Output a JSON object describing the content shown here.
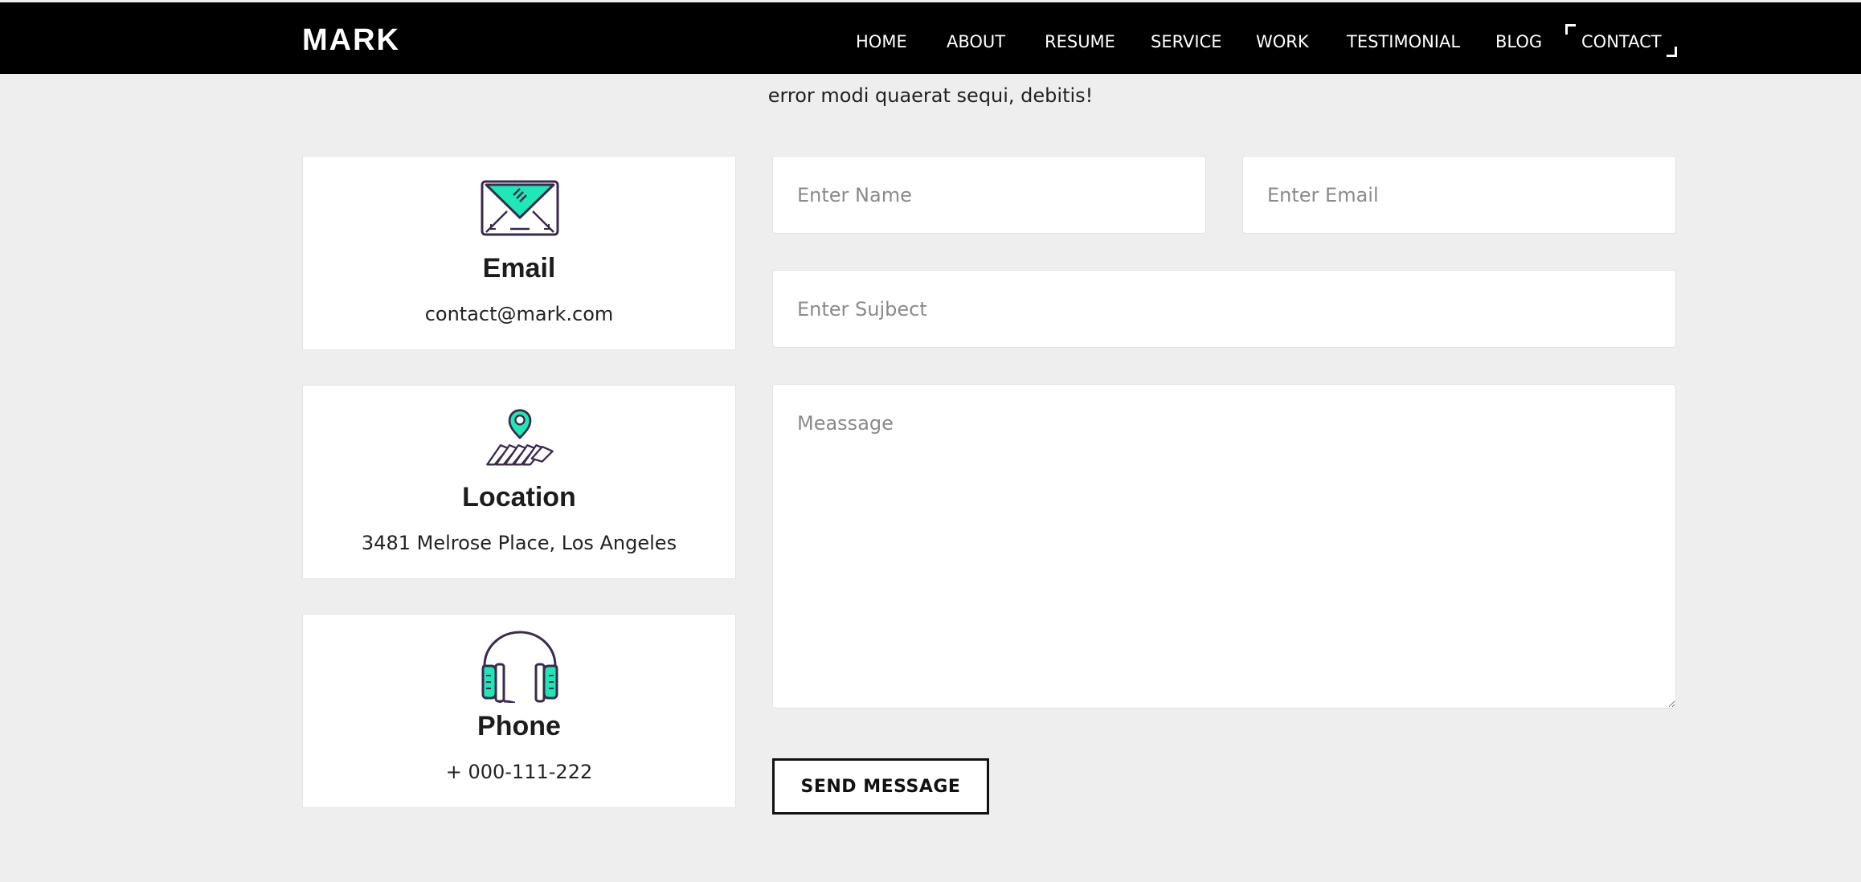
{
  "header": {
    "logo": "MARK",
    "nav": [
      {
        "label": "HOME"
      },
      {
        "label": "ABOUT"
      },
      {
        "label": "RESUME"
      },
      {
        "label": "SERVICE"
      },
      {
        "label": "WORK"
      },
      {
        "label": "TESTIMONIAL"
      },
      {
        "label": "BLOG"
      },
      {
        "label": "CONTACT",
        "active": true
      }
    ]
  },
  "intro": {
    "text": "error modi quaerat sequi, debitis!"
  },
  "contact_cards": [
    {
      "title": "Email",
      "value": "contact@mark.com",
      "icon": "envelope-icon"
    },
    {
      "title": "Location",
      "value": "3481 Melrose Place, Los Angeles",
      "icon": "map-pin-icon"
    },
    {
      "title": "Phone",
      "value": "+ 000-111-222",
      "icon": "headset-icon"
    }
  ],
  "form": {
    "name_placeholder": "Enter Name",
    "email_placeholder": "Enter Email",
    "subject_placeholder": "Enter Sujbect",
    "message_placeholder": "Meassage",
    "submit_label": "SEND MESSAGE"
  },
  "colors": {
    "accent": "#1de9b6",
    "icon_stroke": "#3a2a4d",
    "header_bg": "#000000",
    "page_bg": "#eeeeee"
  }
}
